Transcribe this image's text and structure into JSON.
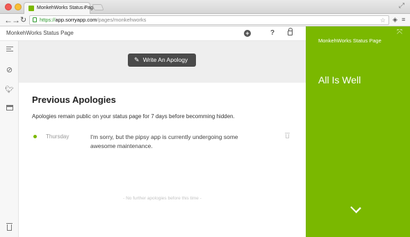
{
  "browser": {
    "tab_title": "MonkehWorks Status Page",
    "tab_close": "×",
    "url_https": "https://",
    "url_host": "app.sorryapp.com",
    "url_path": "/pages/monkehworks",
    "icons": [
      "back-arrow-icon",
      "forward-arrow-icon",
      "reload-icon",
      "star-icon",
      "extension-icon",
      "menu-icon"
    ]
  },
  "header": {
    "title": "MonkehWorks Status Page"
  },
  "toolbar": {
    "write_label": "Write An Apology"
  },
  "apologies": {
    "heading": "Previous Apologies",
    "subtext": "Apologies remain public on your status page for 7 days before becomming hidden.",
    "items": [
      {
        "day": "Thursday",
        "text": "I'm sorry, but the pipsy app is currently undergoing some awesome maintenance.",
        "status_color": "#7ab800"
      }
    ],
    "empty_text": "- No further apologies before this time -"
  },
  "status_panel": {
    "title": "MonkehWorks Status Page",
    "status": "All Is Well",
    "color": "#7ab800"
  }
}
